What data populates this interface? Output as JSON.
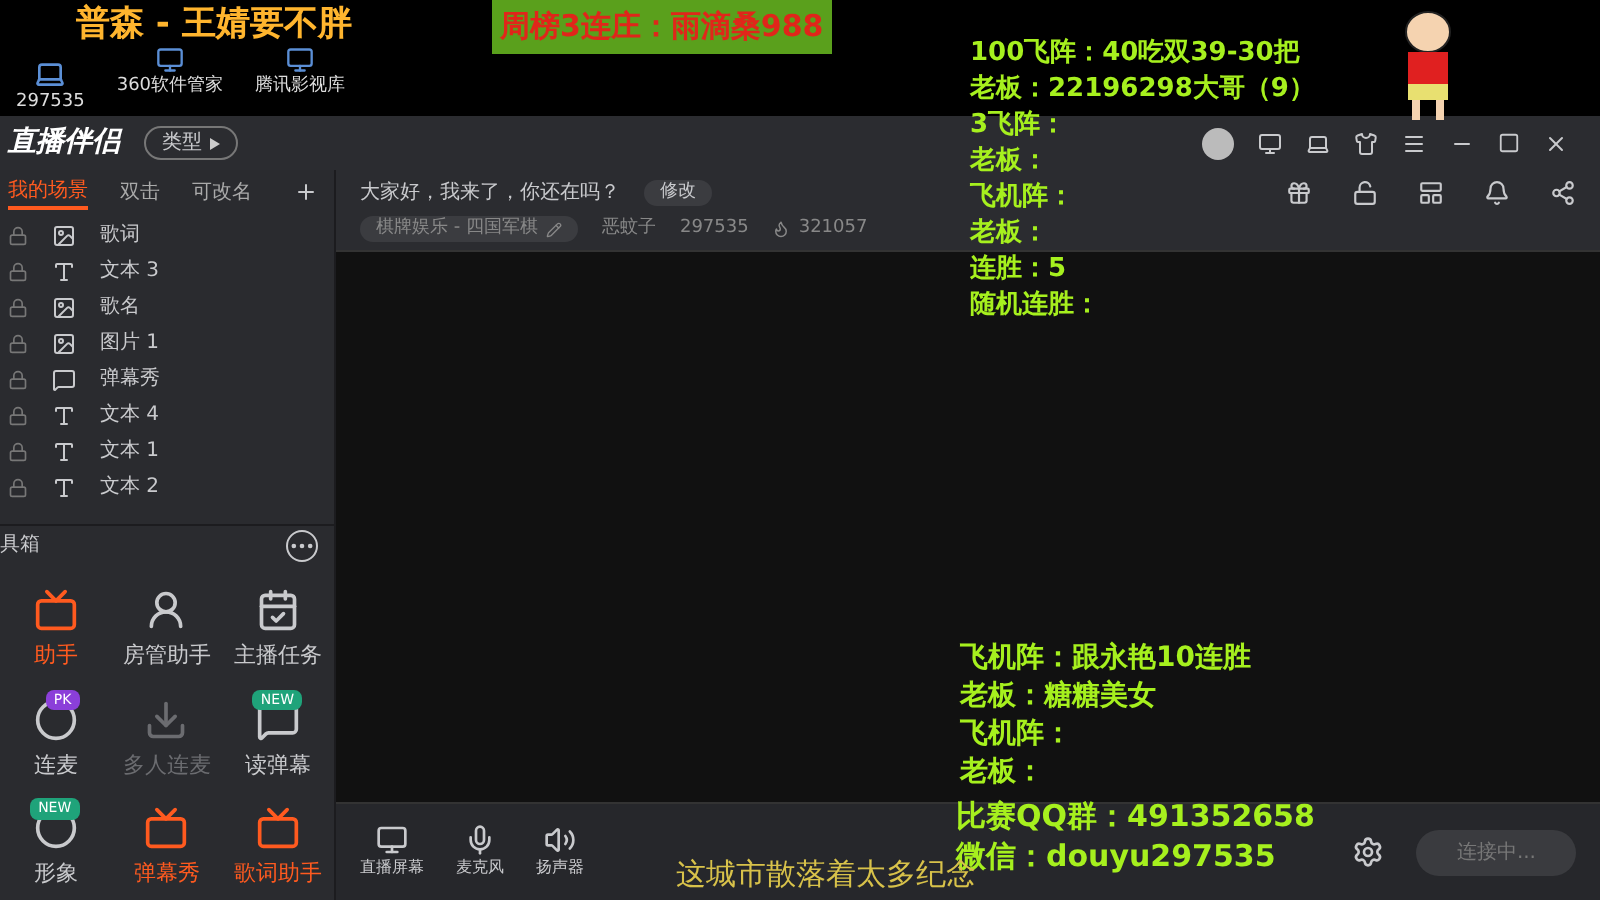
{
  "overlay": {
    "streamer_title": "普森 - 王婧要不胖",
    "desktop_icons": [
      {
        "label": "360软件管家"
      },
      {
        "label": "腾讯影视库"
      }
    ],
    "room_number": "297535",
    "weekly_banner": "周榜3连庄：雨滴桑988",
    "top_list": [
      "100飞阵：40吃双39-30把",
      "老板：22196298大哥（9）",
      "3飞阵：",
      "老板：",
      "飞机阵：",
      "老板：",
      "连胜：5",
      "随机连胜："
    ],
    "bottom_list": [
      "飞机阵：跟永艳10连胜",
      "老板：糖糖美女",
      "飞机阵：",
      "老板："
    ],
    "contacts": [
      "比赛QQ群：491352658",
      "微信：douyu297535"
    ],
    "subtitle": "这城市散落着太多纪念"
  },
  "window": {
    "title": "直播伴侣",
    "type_button": "类型"
  },
  "sidebar": {
    "tabs": [
      {
        "label": "我的场景",
        "selected": true
      },
      {
        "label": "双击",
        "selected": false
      },
      {
        "label": "可改名",
        "selected": false
      }
    ],
    "sources": [
      {
        "kind": "image",
        "label": "歌词"
      },
      {
        "kind": "text",
        "label": "文本 3"
      },
      {
        "kind": "image",
        "label": "歌名"
      },
      {
        "kind": "picture",
        "label": "图片 1"
      },
      {
        "kind": "danmu",
        "label": "弹幕秀"
      },
      {
        "kind": "text",
        "label": "文本 4"
      },
      {
        "kind": "text",
        "label": "文本 1"
      },
      {
        "kind": "text",
        "label": "文本 2"
      }
    ],
    "toolbox_title": "具箱",
    "tools": [
      {
        "label": "助手",
        "highlighted": true,
        "disabled": false
      },
      {
        "label": "房管助手",
        "highlighted": false,
        "disabled": false
      },
      {
        "label": "主播任务",
        "highlighted": false,
        "disabled": false
      },
      {
        "label": "连麦",
        "highlighted": false,
        "disabled": false,
        "badge": "PK"
      },
      {
        "label": "多人连麦",
        "highlighted": false,
        "disabled": true
      },
      {
        "label": "读弹幕",
        "highlighted": false,
        "disabled": false,
        "badge": "NEW"
      },
      {
        "label": "形象",
        "highlighted": false,
        "disabled": false,
        "badge": "NEW"
      },
      {
        "label": "弹幕秀",
        "highlighted": true,
        "disabled": false
      },
      {
        "label": "歌词助手",
        "highlighted": true,
        "disabled": false
      }
    ]
  },
  "header": {
    "greeting": "大家好，我来了，你还在吗？",
    "edit_button": "修改",
    "category": "棋牌娱乐 - 四国军棋",
    "nickname": "恶蚊子",
    "room_id": "297535",
    "popularity": "321057"
  },
  "bottom_bar": {
    "tools": [
      "直播屏幕",
      "麦克风",
      "扬声器"
    ],
    "connect_button": "连接中..."
  }
}
